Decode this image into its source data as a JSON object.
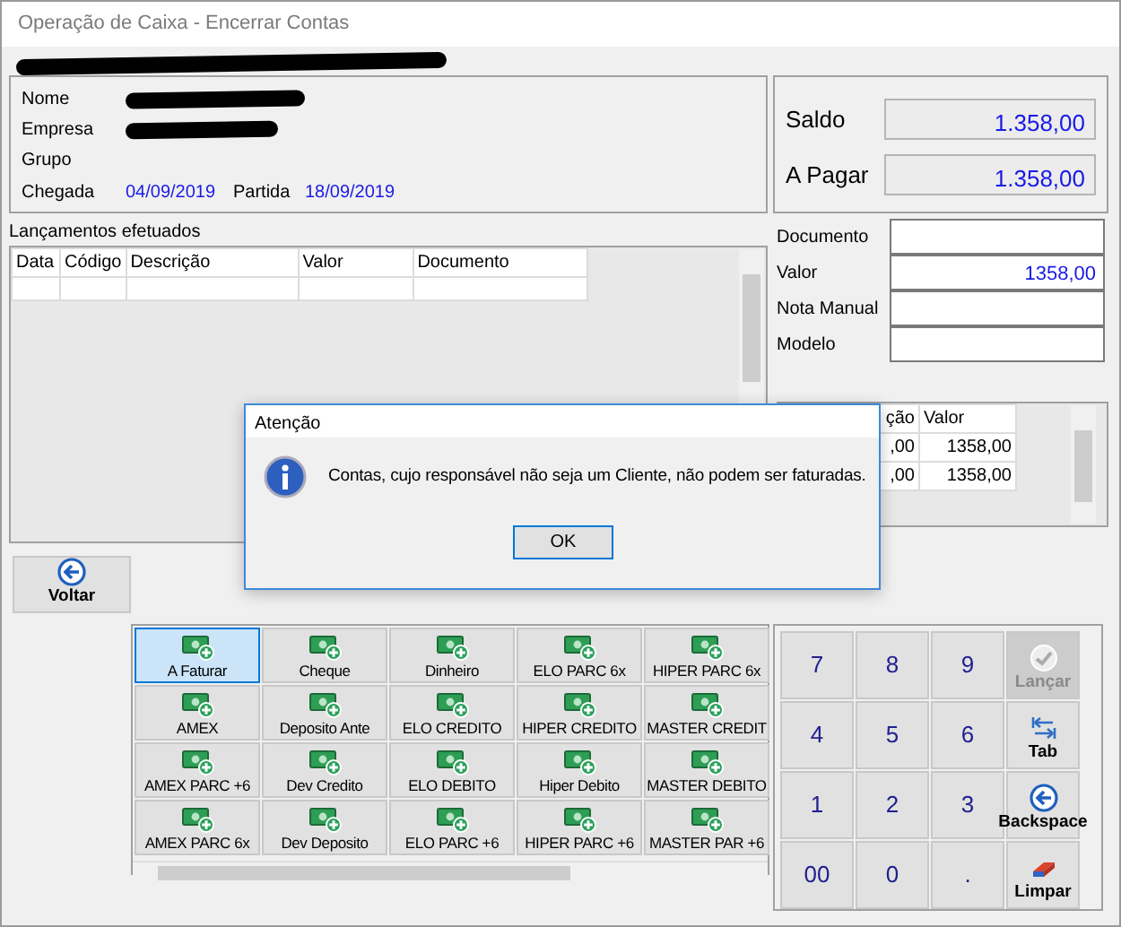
{
  "window": {
    "title": "Operação de Caixa - Encerrar Contas"
  },
  "header": {
    "redacted": true
  },
  "guest": {
    "fields": [
      {
        "label": "Nome",
        "redacted": true
      },
      {
        "label": "Empresa",
        "redacted": true
      },
      {
        "label": "Grupo",
        "redacted": false
      }
    ],
    "arrival": {
      "label": "Chegada",
      "value": "04/09/2019"
    },
    "departure": {
      "label": "Partida",
      "value": "18/09/2019"
    }
  },
  "totals": [
    {
      "label": "Saldo",
      "value": "1.358,00"
    },
    {
      "label": "A Pagar",
      "value": "1.358,00"
    }
  ],
  "entries": {
    "title": "Lançamentos efetuados",
    "columns": [
      "Data",
      "Código",
      "Descrição",
      "Valor",
      "Documento"
    ]
  },
  "payment_form": [
    {
      "label": "Documento"
    },
    {
      "label": "Valor",
      "value": "1358,00"
    },
    {
      "label": "Nota Manual"
    },
    {
      "label": "Modelo"
    }
  ],
  "payments_grid": {
    "columns": [
      "ção",
      "Valor"
    ],
    "rows": [
      [
        ",00",
        "1358,00"
      ],
      [
        ",00",
        "1358,00"
      ]
    ]
  },
  "back_button": {
    "label": "Voltar"
  },
  "payment_methods": [
    {
      "label": "A Faturar",
      "selected": true
    },
    {
      "label": "Cheque",
      "selected": false
    },
    {
      "label": "Dinheiro",
      "selected": false
    },
    {
      "label": "ELO PARC 6x",
      "selected": false
    },
    {
      "label": "HIPER PARC 6x",
      "selected": false
    },
    {
      "label": "AMEX",
      "selected": false
    },
    {
      "label": "Deposito Ante",
      "selected": false
    },
    {
      "label": "ELO CREDITO",
      "selected": false
    },
    {
      "label": "HIPER CREDITO",
      "selected": false
    },
    {
      "label": "MASTER CREDIT",
      "selected": false
    },
    {
      "label": "AMEX PARC +6",
      "selected": false
    },
    {
      "label": "Dev Credito",
      "selected": false
    },
    {
      "label": "ELO DEBITO",
      "selected": false
    },
    {
      "label": "Hiper Debito",
      "selected": false
    },
    {
      "label": "MASTER DEBITO",
      "selected": false
    },
    {
      "label": "AMEX PARC 6x",
      "selected": false
    },
    {
      "label": "Dev Deposito",
      "selected": false
    },
    {
      "label": "ELO PARC +6",
      "selected": false
    },
    {
      "label": "HIPER PARC +6",
      "selected": false
    },
    {
      "label": "MASTER PAR +6",
      "selected": false
    }
  ],
  "keypad": [
    {
      "label": "7",
      "kind": "digit",
      "disabled": false
    },
    {
      "label": "8",
      "kind": "digit",
      "disabled": false
    },
    {
      "label": "9",
      "kind": "digit",
      "disabled": false
    },
    {
      "label": "Lançar",
      "kind": "confirm",
      "disabled": true
    },
    {
      "label": "4",
      "kind": "digit",
      "disabled": false
    },
    {
      "label": "5",
      "kind": "digit",
      "disabled": false
    },
    {
      "label": "6",
      "kind": "digit",
      "disabled": false
    },
    {
      "label": "Tab",
      "kind": "tab",
      "disabled": false
    },
    {
      "label": "1",
      "kind": "digit",
      "disabled": false
    },
    {
      "label": "2",
      "kind": "digit",
      "disabled": false
    },
    {
      "label": "3",
      "kind": "digit",
      "disabled": false
    },
    {
      "label": "Backspace",
      "kind": "backspace",
      "disabled": false
    },
    {
      "label": "00",
      "kind": "digit",
      "disabled": false
    },
    {
      "label": "0",
      "kind": "digit",
      "disabled": false
    },
    {
      "label": ".",
      "kind": "digit",
      "disabled": false
    },
    {
      "label": "Limpar",
      "kind": "clear",
      "disabled": false
    }
  ],
  "dialog": {
    "title": "Atenção",
    "message": "Contas, cujo responsável não seja um Cliente, não podem ser faturadas.",
    "button": "OK"
  }
}
